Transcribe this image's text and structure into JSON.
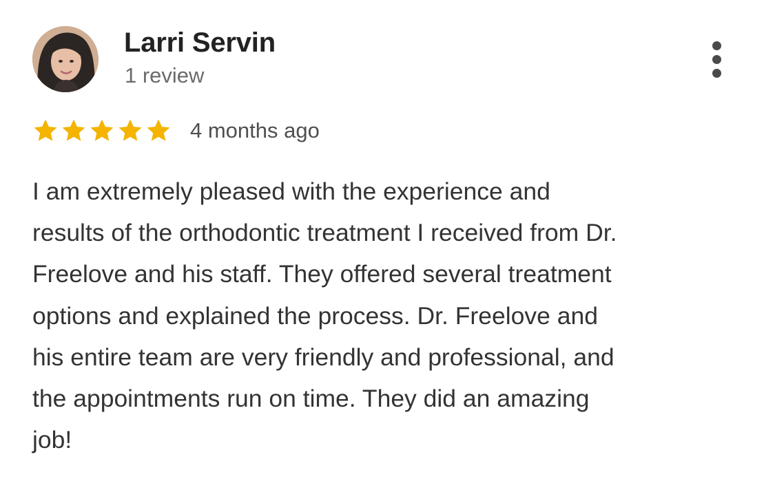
{
  "reviewer": {
    "name": "Larri Servin",
    "review_count": "1 review",
    "avatar_icon": "profile-photo"
  },
  "menu": {
    "icon": "more-vertical-icon"
  },
  "rating": {
    "stars": 5,
    "max_stars": 5,
    "star_color": "#F4B400",
    "time_ago": "4 months ago"
  },
  "review": {
    "lines": [
      "I am extremely pleased with the experience and",
      "results of the orthodontic treatment I received from Dr.",
      "Freelove and his staff. They offered several treatment",
      "options and explained the process. Dr. Freelove and",
      "his entire team are very friendly and professional, and",
      "the appointments run on time. They did an amazing",
      "job!"
    ]
  }
}
